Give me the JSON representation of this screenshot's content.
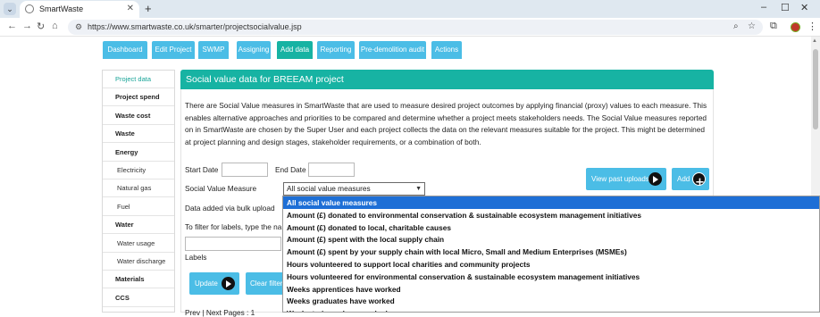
{
  "browser": {
    "tab_title": "SmartWaste",
    "url": "https://www.smartwaste.co.uk/smarter/projectsocialvalue.jsp",
    "tab_collapse_icon": "chevron-down-icon",
    "new_tab_label": "+"
  },
  "app_tabs": [
    "Dashboard",
    "Edit Project",
    "SWMP",
    "Assigning",
    "Add data",
    "Reporting",
    "Pre-demolition audit",
    "Actions"
  ],
  "active_tab": "Add data",
  "sidebar": {
    "items": [
      {
        "label": "Project data",
        "type": "current"
      },
      {
        "label": "Project spend",
        "type": "cat"
      },
      {
        "label": "Waste cost",
        "type": "cat"
      },
      {
        "label": "Waste",
        "type": "cat"
      },
      {
        "label": "Energy",
        "type": "cat"
      },
      {
        "label": "Electricity",
        "type": "sub"
      },
      {
        "label": "Natural gas",
        "type": "sub"
      },
      {
        "label": "Fuel",
        "type": "sub"
      },
      {
        "label": "Water",
        "type": "cat"
      },
      {
        "label": "Water usage",
        "type": "sub"
      },
      {
        "label": "Water discharge",
        "type": "sub"
      },
      {
        "label": "Materials",
        "type": "cat"
      },
      {
        "label": "CCS",
        "type": "cat"
      }
    ]
  },
  "main": {
    "title": "Social value data for BREEAM project",
    "intro": "There are Social Value measures in SmartWaste that are used to measure desired project outcomes by applying financial (proxy) values to each measure. This enables alternative approaches and priorities to be compared and determine whether a project meets stakeholders needs. The Social Value measures reported on in SmartWaste are chosen by the Super User and each project collects the data on the relevant measures suitable for the project. This might be determined at project planning and design stages, stakeholder requirements, or a combination of both.",
    "start_date_label": "Start Date",
    "end_date_label": "End Date",
    "start_date_value": "",
    "end_date_value": "",
    "measure_label": "Social Value Measure",
    "measure_selected": "All social value measures",
    "bulk_label": "Data added via bulk upload",
    "filter_label": "To filter for labels, type the na",
    "labels_label": "Labels",
    "update_button": "Update",
    "clear_filters_button": "Clear filters",
    "view_uploads_button": "View past uploads",
    "add_button": "Add",
    "paging_text": "Prev | Next    Pages : 1"
  },
  "dropdown_options": [
    "All social value measures",
    "Amount (£) donated to environmental conservation & sustainable ecosystem management initiatives",
    "Amount (£) donated to local, charitable causes",
    "Amount (£) spent with the local supply chain",
    "Amount (£) spent by your supply chain with local Micro, Small and Medium Enterprises (MSMEs)",
    "Hours volunteered to support local charities and community projects",
    "Hours volunteered for environmental conservation & sustainable ecosystem management initiatives",
    "Weeks apprentices have worked",
    "Weeks graduates have worked",
    "Weeks trainees have worked"
  ],
  "colors": {
    "teal": "#17b3a3",
    "tab_blue": "#4bbde6",
    "selection_blue": "#1e6fd6"
  }
}
